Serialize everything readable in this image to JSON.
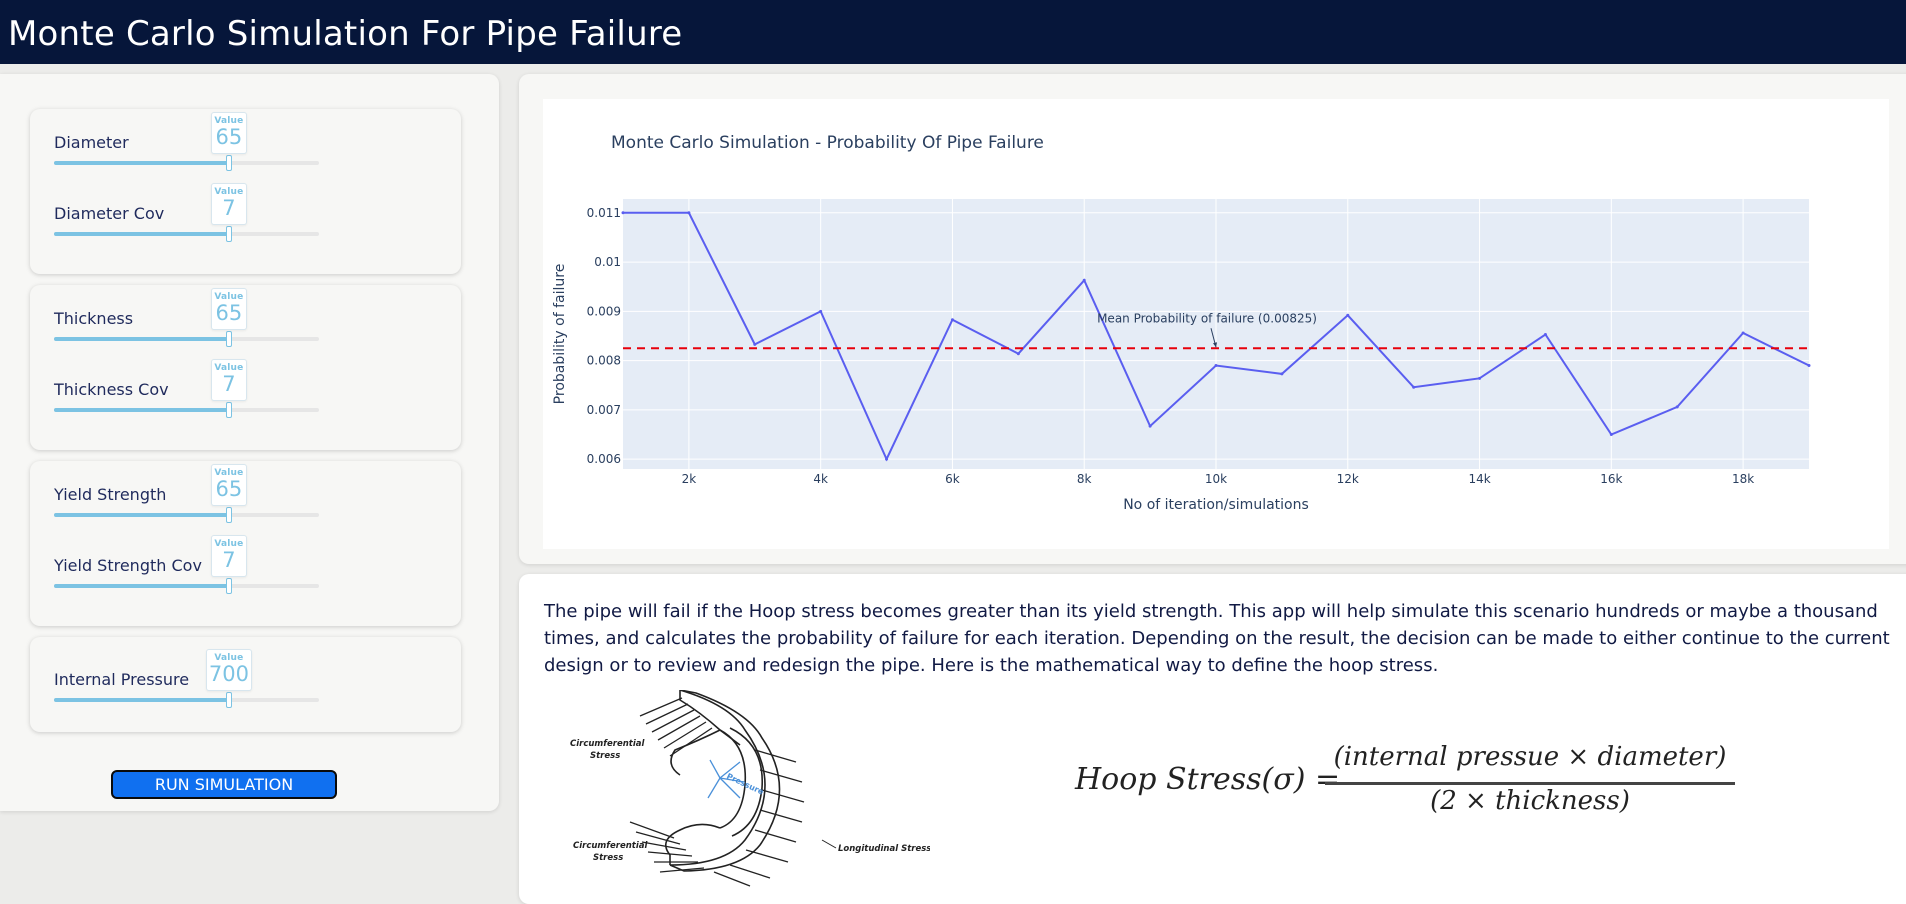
{
  "header": {
    "title": "Monte Carlo Simulation For Pipe Failure"
  },
  "sliders": {
    "value_caption": "Value",
    "diameter": {
      "label": "Diameter",
      "value": "65",
      "fraction": 0.66
    },
    "diameter_cov": {
      "label": "Diameter Cov",
      "value": "7",
      "fraction": 0.66
    },
    "thickness": {
      "label": "Thickness",
      "value": "65",
      "fraction": 0.66
    },
    "thickness_cov": {
      "label": "Thickness Cov",
      "value": "7",
      "fraction": 0.66
    },
    "yield_strength": {
      "label": "Yield Strength",
      "value": "65",
      "fraction": 0.66
    },
    "yield_strength_cov": {
      "label": "Yield Strength Cov",
      "value": "7",
      "fraction": 0.66
    },
    "internal_pressure": {
      "label": "Internal Pressure",
      "value": "700",
      "fraction": 0.66
    }
  },
  "run_button": {
    "label": "RUN SIMULATION"
  },
  "chart_data": {
    "type": "line",
    "title": "Monte Carlo Simulation - Probability Of Pipe Failure",
    "xlabel": "No of iteration/simulations",
    "ylabel": "Probability of failure",
    "x": [
      1000,
      2000,
      3000,
      4000,
      5000,
      6000,
      7000,
      8000,
      9000,
      10000,
      11000,
      12000,
      13000,
      14000,
      15000,
      16000,
      17000,
      18000,
      19000
    ],
    "y": [
      0.011,
      0.011,
      0.00833,
      0.009,
      0.006,
      0.00883,
      0.00814,
      0.00963,
      0.00667,
      0.0079,
      0.00773,
      0.00892,
      0.00746,
      0.00764,
      0.00853,
      0.0065,
      0.00706,
      0.00856,
      0.0079
    ],
    "xlim": [
      1000,
      19000
    ],
    "ylim": [
      0.0058,
      0.01128
    ],
    "x_ticks": [
      2000,
      4000,
      6000,
      8000,
      10000,
      12000,
      14000,
      16000,
      18000
    ],
    "x_tick_labels": [
      "2k",
      "4k",
      "6k",
      "8k",
      "10k",
      "12k",
      "14k",
      "16k",
      "18k"
    ],
    "y_ticks": [
      0.006,
      0.007,
      0.008,
      0.009,
      0.01,
      0.011
    ],
    "y_tick_labels": [
      "0.006",
      "0.007",
      "0.008",
      "0.009",
      "0.01",
      "0.011"
    ],
    "mean_line": {
      "value": 0.00825,
      "color": "#e8000b"
    },
    "annotation": {
      "text": "Mean Probability of failure (0.00825)",
      "x": 10000,
      "y": 0.00825
    },
    "line_color": "#5a5ef0",
    "plot_bg": "#e5ecf6",
    "grid": true
  },
  "description": {
    "text": "The pipe will fail if the Hoop stress becomes greater than its yield strength. This app will help simulate this scenario hundreds or maybe a thousand times, and calculates the probability of failure for each iteration. Depending on the result, the decision can be made to either continue to the current design or to review and redesign the pipe. Here is the mathematical way to define the hoop stress."
  },
  "diagram": {
    "circ_stress_top": [
      "Circumferential",
      "Stress"
    ],
    "circ_stress_bottom": [
      "Circumferential",
      "Stress"
    ],
    "longitudinal": "Longitudinal Stress",
    "pressure": "Pressure"
  },
  "formula": {
    "lhs": "Hoop Stress(σ) =",
    "numerator": "(internal pressue  × diameter)",
    "denominator": "(2  × thickness)"
  }
}
